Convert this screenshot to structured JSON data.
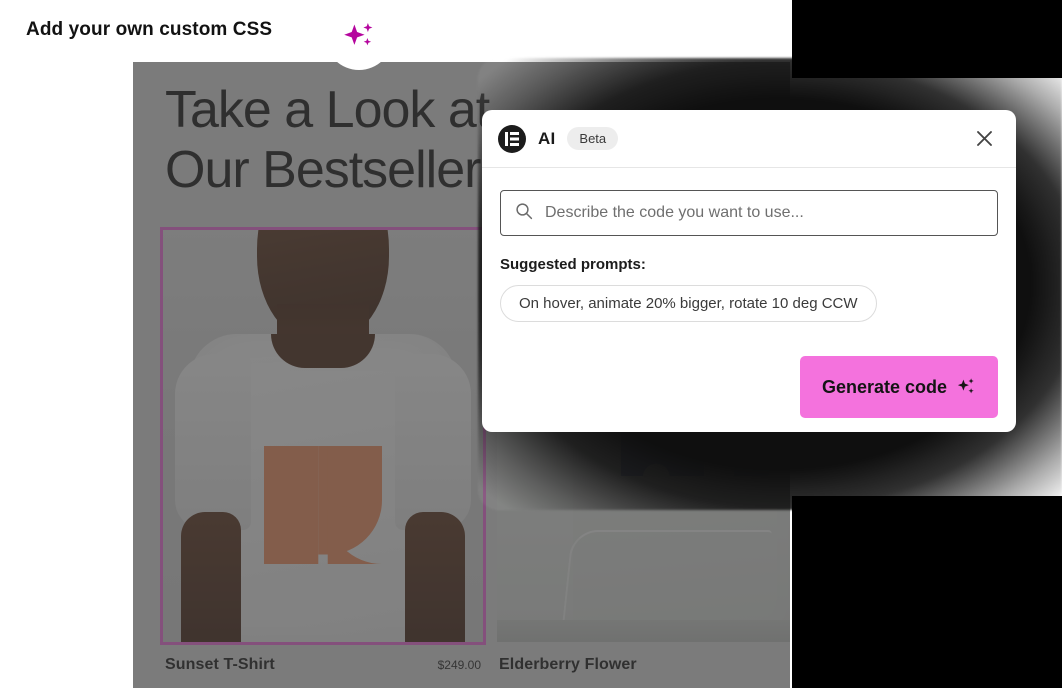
{
  "tooltip": {
    "text": "Add your own custom CSS",
    "icon": "sparkles-icon"
  },
  "canvas": {
    "heading": "Take a Look at\nOur Bestsellers",
    "selection_color": "#f06fdc",
    "overlay_color": "rgba(60,60,60,0.60)",
    "products": [
      {
        "name": "Sunset T-Shirt",
        "price": "$249.00",
        "selected": true,
        "image_alt": "man-in-white-tshirt-photo"
      },
      {
        "name": "Elderberry Flower",
        "price": "",
        "selected": false,
        "image_alt": "grey-hoodie-photo"
      }
    ]
  },
  "ai_panel": {
    "brand": {
      "logo_icon": "elementor-logo-icon",
      "title": "AI",
      "badge": "Beta"
    },
    "close_icon": "close-icon",
    "search": {
      "icon": "search-icon",
      "value": "",
      "placeholder": "Describe the code you want to use..."
    },
    "suggested": {
      "label": "Suggested prompts:",
      "chips": [
        "On hover, animate 20% bigger, rotate 10 deg CCW"
      ]
    },
    "generate": {
      "label": "Generate code",
      "icon": "sparkles-icon",
      "color": "#f472dd"
    }
  }
}
